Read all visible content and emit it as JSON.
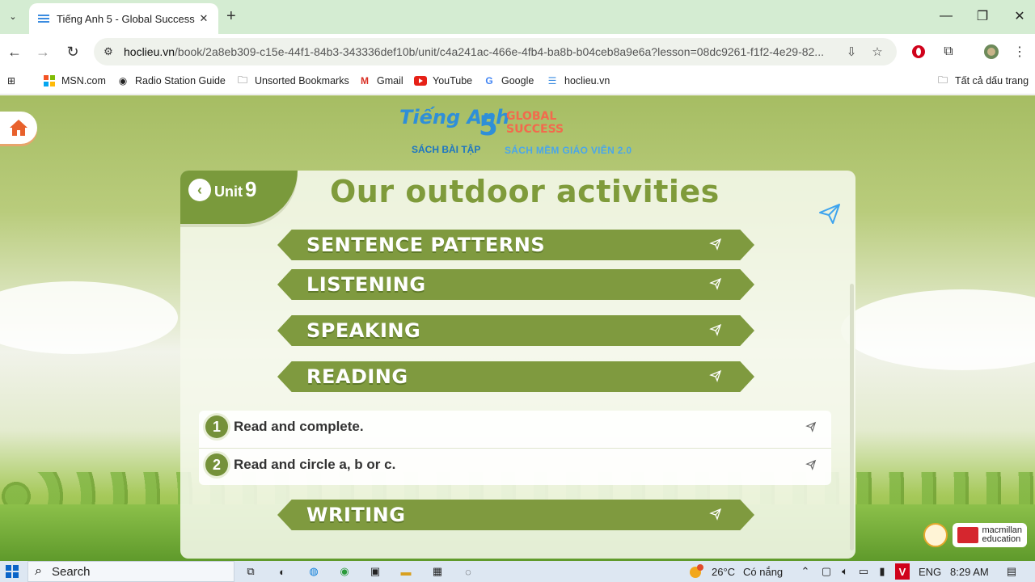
{
  "browser": {
    "tab_title": "Tiếng Anh 5 - Global Success - ",
    "tab_close": "✕",
    "new_tab": "+",
    "url_host": "hoclieu.vn",
    "url_path": "/book/2a8eb309-c15e-44f1-84b3-343336def10b/unit/c4a241ac-466e-4fb4-ba8b-b04ceb8a9e6a?lesson=08dc9261-f1f2-4e29-82...",
    "bookmarks": [
      {
        "label": "MSN.com",
        "icon": "msn-icon"
      },
      {
        "label": "Radio Station Guide",
        "icon": "radio-icon"
      },
      {
        "label": "Unsorted Bookmarks",
        "icon": "folder-icon"
      },
      {
        "label": "Gmail",
        "icon": "gmail-icon"
      },
      {
        "label": "YouTube",
        "icon": "youtube-icon"
      },
      {
        "label": "Google",
        "icon": "google-icon"
      },
      {
        "label": "hoclieu.vn",
        "icon": "hoclieu-icon"
      }
    ],
    "all_bookmarks": "Tất cả dấu trang"
  },
  "page": {
    "logo": {
      "tieng_anh": "Tiếng Anh",
      "grade": "5",
      "global_success": "GLOBAL SUCCESS",
      "subtitle_left": "SÁCH BÀI TẬP",
      "subtitle_right": "SÁCH MỀM GIÁO VIÊN 2.0"
    },
    "unit": {
      "label": "Unit",
      "number": "9",
      "title": "Our outdoor activities"
    },
    "sections": [
      {
        "label": "SENTENCE PATTERNS"
      },
      {
        "label": "LISTENING"
      },
      {
        "label": "SPEAKING"
      },
      {
        "label": "READING"
      }
    ],
    "lessons": [
      {
        "number": "1",
        "label": "Read and complete."
      },
      {
        "number": "2",
        "label": "Read and circle a, b or c."
      }
    ],
    "section_after": {
      "label": "WRITING"
    },
    "brand": {
      "macmillan_line1": "macmillan",
      "macmillan_line2": "education"
    }
  },
  "taskbar": {
    "search_label": "Search",
    "weather_temp": "26°C",
    "weather_text": "Có nắng",
    "weather_badge": "4",
    "language": "ENG",
    "time": "8:29 AM"
  },
  "colors": {
    "banner": "#7f9a3f",
    "accent_green": "#7a9a3c",
    "tab_strip": "#d4ecd2"
  }
}
